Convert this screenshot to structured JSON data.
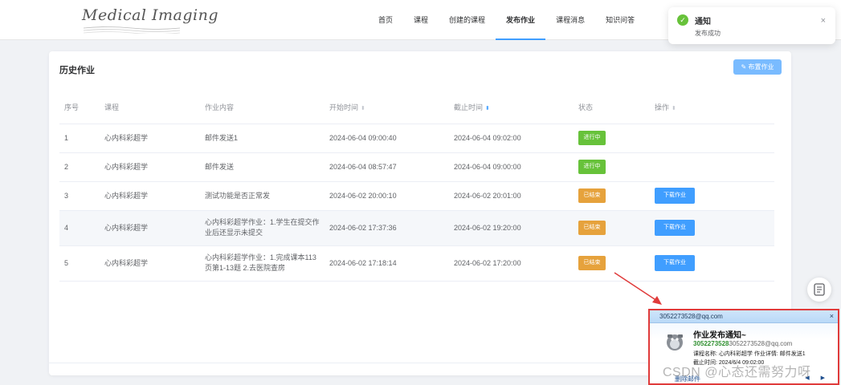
{
  "header": {
    "logo_text": "Medical Imaging",
    "nav": [
      {
        "label": "首页",
        "active": false
      },
      {
        "label": "课程",
        "active": false
      },
      {
        "label": "创建的课程",
        "active": false
      },
      {
        "label": "发布作业",
        "active": true
      },
      {
        "label": "课程消息",
        "active": false
      },
      {
        "label": "知识问答",
        "active": false
      }
    ]
  },
  "notification": {
    "icon": "check-circle-icon",
    "title": "通知",
    "message": "发布成功",
    "close": "×"
  },
  "card": {
    "title": "历史作业",
    "assign_button": "布置作业"
  },
  "table": {
    "headers": [
      "序号",
      "课程",
      "作业内容",
      "开始时间",
      "截止时间",
      "状态",
      "操作"
    ],
    "rows": [
      {
        "no": "1",
        "course": "心内科彩超学",
        "content": "邮件发送1",
        "start": "2024-06-04 09:00:40",
        "end": "2024-06-04 09:02:00",
        "status": "进行中",
        "status_color": "#67c23a",
        "action": ""
      },
      {
        "no": "2",
        "course": "心内科彩超学",
        "content": "邮件发送",
        "start": "2024-06-04 08:57:47",
        "end": "2024-06-04 09:00:00",
        "status": "进行中",
        "status_color": "#67c23a",
        "action": ""
      },
      {
        "no": "3",
        "course": "心内科彩超学",
        "content": "测试功能是否正常发",
        "start": "2024-06-02 20:00:10",
        "end": "2024-06-02 20:01:00",
        "status": "已结束",
        "status_color": "#e6a23c",
        "action": "下载作业"
      },
      {
        "no": "4",
        "course": "心内科彩超学",
        "content_l1": "心内科彩超学作业：1.学生在提交作",
        "content_l2": "业后还显示未提交",
        "start": "2024-06-02 17:37:36",
        "end": "2024-06-02 19:20:00",
        "status": "已结束",
        "status_color": "#e6a23c",
        "action": "下载作业"
      },
      {
        "no": "5",
        "course": "心内科彩超学",
        "content_l1": "心内科彩超学作业：1.完成课本113",
        "content_l2": "页第1-13题 2.去医院查房",
        "start": "2024-06-02 17:18:14",
        "end": "2024-06-02 17:20:00",
        "status": "已结束",
        "status_color": "#e6a23c",
        "action": "下载作业"
      }
    ]
  },
  "float_button": {
    "icon": "document-list-icon"
  },
  "email": {
    "from": "3052273528@qq.com",
    "close": "×",
    "subject": "作业发布通知~",
    "account_bold": "3052273528",
    "account_rest": "3052273528@qq.com",
    "detail": "课程名称: 心内科彩超学 作业详情: 邮件发送1",
    "deadline": "截止时间: 2024/6/4 09:02:00",
    "delete": "删除邮件",
    "nav": "◀ ▶"
  },
  "watermark": "CSDN @心态还需努力呀",
  "colors": {
    "primary": "#409eff",
    "success": "#67c23a",
    "warning": "#e6a23c",
    "highlight": "#e03b3b"
  }
}
